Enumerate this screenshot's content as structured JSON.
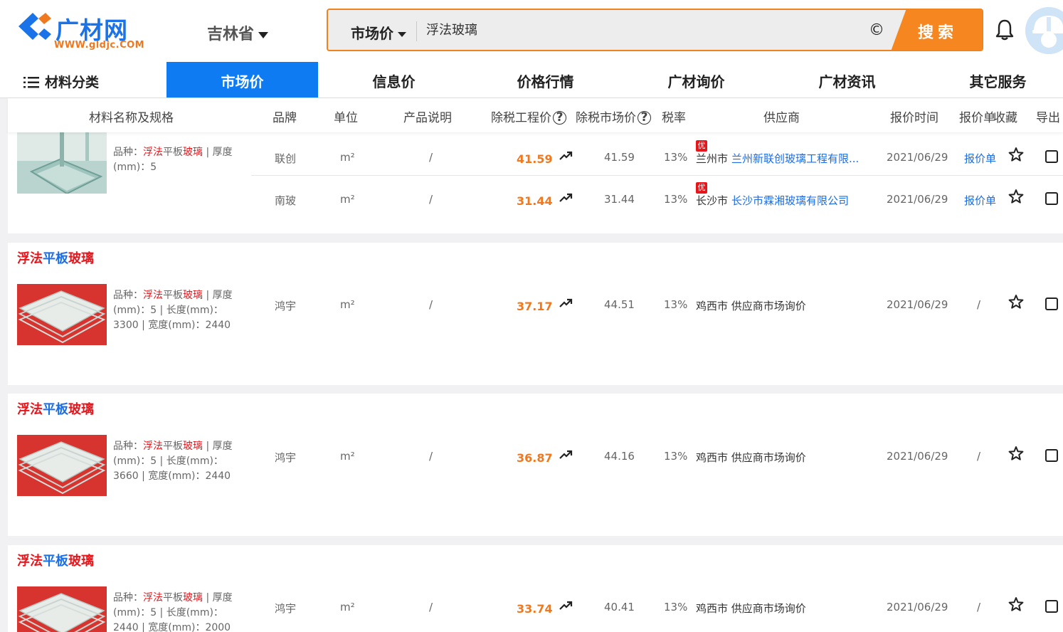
{
  "header": {
    "logo_name": "广材网",
    "logo_url": "WWW.gldjc.COM",
    "region": "吉林省",
    "search_type": "市场价",
    "search_query": "浮法玻璃",
    "clear_glyph": "©",
    "search_button": "搜索",
    "accent_color": "#f6861f",
    "brand_color": "#1a73e8"
  },
  "nav": {
    "category_label": "材料分类",
    "tabs": [
      "市场价",
      "信息价",
      "价格行情",
      "广材询价",
      "广材资讯",
      "其它服务"
    ],
    "active_tab": "市场价"
  },
  "columns": {
    "name": "材料名称及规格",
    "brand": "品牌",
    "unit": "单位",
    "desc": "产品说明",
    "eng_price": "除税工程价",
    "mkt_price": "除税市场价",
    "tax": "税率",
    "supplier": "供应商",
    "time": "报价时间",
    "quote": "报价单",
    "fav": "收藏",
    "export": "导出"
  },
  "help_glyph": "?",
  "badge_text": "优",
  "cards": [
    {
      "spec_prefix": "品种：",
      "spec_highlight_1": "浮法",
      "spec_mid": "平板",
      "spec_highlight_2": "玻璃",
      "spec_rest": " | 厚度(mm)：5",
      "rows": [
        {
          "brand": "联创",
          "unit": "m²",
          "desc": "/",
          "eng_price": "41.59",
          "mkt_price": "41.59",
          "tax": "13%",
          "city": "兰州市",
          "supplier": "兰州新联创玻璃工程有限...",
          "time": "2021/06/29",
          "quote": "报价单"
        },
        {
          "brand": "南玻",
          "unit": "m²",
          "desc": "/",
          "eng_price": "31.44",
          "mkt_price": "31.44",
          "tax": "13%",
          "city": "长沙市",
          "supplier": "长沙市霖湘玻璃有限公司",
          "time": "2021/06/29",
          "quote": "报价单"
        }
      ]
    },
    {
      "title_1": "浮法",
      "title_2": "平板",
      "title_3": "玻璃",
      "spec_prefix": "品种：",
      "spec_highlight_1": "浮法",
      "spec_mid": "平板",
      "spec_highlight_2": "玻璃",
      "spec_rest": " | 厚度(mm)：5 | 长度(mm)：3300 | 宽度(mm)：2440",
      "row": {
        "brand": "鸿宇",
        "unit": "m²",
        "desc": "/",
        "eng_price": "37.17",
        "mkt_price": "44.51",
        "tax": "13%",
        "supplier": "鸡西市 供应商市场询价",
        "time": "2021/06/29",
        "quote": "/"
      }
    },
    {
      "title_1": "浮法",
      "title_2": "平板",
      "title_3": "玻璃",
      "spec_prefix": "品种：",
      "spec_highlight_1": "浮法",
      "spec_mid": "平板",
      "spec_highlight_2": "玻璃",
      "spec_rest": " | 厚度(mm)：5 | 长度(mm)：3660 | 宽度(mm)：2440",
      "row": {
        "brand": "鸿宇",
        "unit": "m²",
        "desc": "/",
        "eng_price": "36.87",
        "mkt_price": "44.16",
        "tax": "13%",
        "supplier": "鸡西市 供应商市场询价",
        "time": "2021/06/29",
        "quote": "/"
      }
    },
    {
      "title_1": "浮法",
      "title_2": "平板",
      "title_3": "玻璃",
      "spec_prefix": "品种：",
      "spec_highlight_1": "浮法",
      "spec_mid": "平板",
      "spec_highlight_2": "玻璃",
      "spec_rest": " | 厚度(mm)：5 | 长度(mm)：2440 | 宽度(mm)：2000",
      "row": {
        "brand": "鸿宇",
        "unit": "m²",
        "desc": "/",
        "eng_price": "33.74",
        "mkt_price": "40.41",
        "tax": "13%",
        "supplier": "鸡西市 供应商市场询价",
        "time": "2021/06/29",
        "quote": "/"
      }
    }
  ]
}
